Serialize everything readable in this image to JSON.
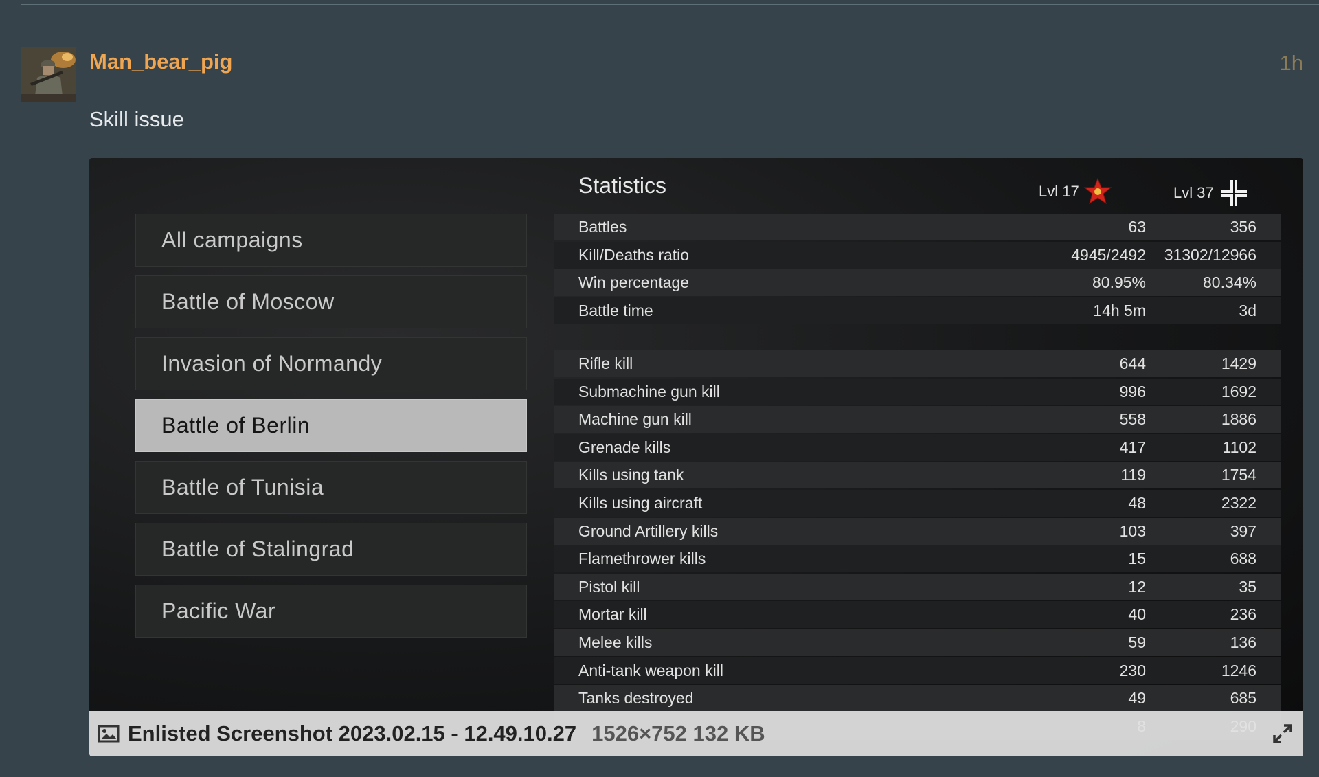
{
  "post": {
    "username": "Man_bear_pig",
    "time": "1h",
    "text": "Skill issue",
    "avatar_icon": "soldier-avatar"
  },
  "screenshot": {
    "menu": [
      {
        "label": "All campaigns",
        "active": false
      },
      {
        "label": "Battle of Moscow",
        "active": false
      },
      {
        "label": "Invasion of Normandy",
        "active": false
      },
      {
        "label": "Battle of Berlin",
        "active": true
      },
      {
        "label": "Battle of Tunisia",
        "active": false
      },
      {
        "label": "Battle of Stalingrad",
        "active": false
      },
      {
        "label": "Pacific War",
        "active": false
      }
    ],
    "stats_title": "Statistics",
    "levels": [
      {
        "label": "Lvl 17",
        "icon": "soviet-star-icon"
      },
      {
        "label": "Lvl 37",
        "icon": "german-cross-icon"
      }
    ],
    "summary_rows": [
      {
        "name": "Battles",
        "v1": "63",
        "v2": "356"
      },
      {
        "name": "Kill/Deaths ratio",
        "v1": "4945/2492",
        "v2": "31302/12966"
      },
      {
        "name": "Win percentage",
        "v1": "80.95%",
        "v2": "80.34%"
      },
      {
        "name": "Battle time",
        "v1": "14h 5m",
        "v2": "3d"
      }
    ],
    "kill_rows": [
      {
        "name": "Rifle kill",
        "v1": "644",
        "v2": "1429"
      },
      {
        "name": "Submachine gun kill",
        "v1": "996",
        "v2": "1692"
      },
      {
        "name": "Machine gun kill",
        "v1": "558",
        "v2": "1886"
      },
      {
        "name": "Grenade kills",
        "v1": "417",
        "v2": "1102"
      },
      {
        "name": "Kills using tank",
        "v1": "119",
        "v2": "1754"
      },
      {
        "name": "Kills using aircraft",
        "v1": "48",
        "v2": "2322"
      },
      {
        "name": "Ground Artillery kills",
        "v1": "103",
        "v2": "397"
      },
      {
        "name": "Flamethrower kills",
        "v1": "15",
        "v2": "688"
      },
      {
        "name": "Pistol kill",
        "v1": "12",
        "v2": "35"
      },
      {
        "name": "Mortar kill",
        "v1": "40",
        "v2": "236"
      },
      {
        "name": "Melee kills",
        "v1": "59",
        "v2": "136"
      },
      {
        "name": "Anti-tank weapon kill",
        "v1": "230",
        "v2": "1246"
      },
      {
        "name": "Tanks destroyed",
        "v1": "49",
        "v2": "685"
      },
      {
        "name": "",
        "v1": "8",
        "v2": "290"
      }
    ]
  },
  "caption": {
    "filename": "Enlisted Screenshot 2023.02.15 - 12.49.10.27",
    "meta": "1526×752 132 KB",
    "image_icon": "image-icon",
    "expand_icon": "expand-icon"
  },
  "colors": {
    "page_bg": "#36434b",
    "username": "#f0a550",
    "time": "#8c7b57",
    "active_menu": "#b9b9b9"
  }
}
